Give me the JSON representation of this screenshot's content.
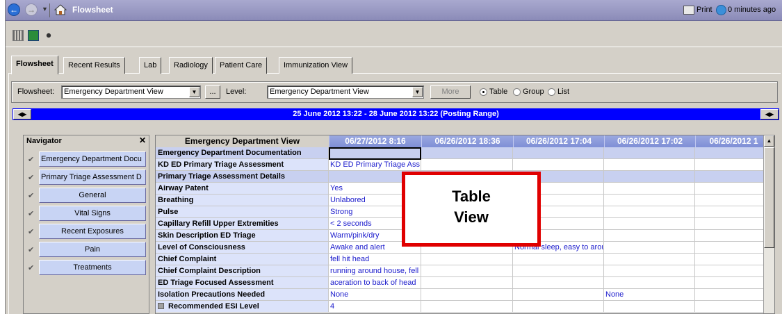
{
  "window": {
    "title": "Flowsheet",
    "print_label": "Print",
    "refresh_label": "0 minutes ago"
  },
  "tabs": [
    "Flowsheet",
    "Recent Results",
    "Lab",
    "Radiology",
    "Patient Care",
    "Immunization View"
  ],
  "filters": {
    "flowsheet_label": "Flowsheet:",
    "flowsheet_value": "Emergency Department View",
    "ellipsis": "...",
    "level_label": "Level:",
    "level_value": "Emergency Department View",
    "more_label": "More",
    "view_options": [
      "Table",
      "Group",
      "List"
    ],
    "selected_view": "Table"
  },
  "range": {
    "text": "25 June 2012 13:22 - 28 June 2012 13:22 (Posting Range)"
  },
  "navigator": {
    "title": "Navigator",
    "items": [
      "Emergency Department Docu",
      "Primary Triage Assessment D",
      "General",
      "Vital Signs",
      "Recent Exposures",
      "Pain",
      "Treatments"
    ]
  },
  "grid": {
    "first_header": "Emergency Department View",
    "columns": [
      "06/27/2012 8:16",
      "06/26/2012 18:36",
      "06/26/2012 17:04",
      "06/26/2012 17:02",
      "06/26/2012 1"
    ],
    "rows": [
      {
        "label": "Emergency Department Documentation",
        "section": true,
        "cells": [
          "",
          "",
          "",
          "",
          ""
        ]
      },
      {
        "label": "KD ED Primary Triage Assessment",
        "section": false,
        "cells": [
          "KD ED Primary Triage Ass",
          "",
          "",
          "",
          ""
        ]
      },
      {
        "label": "Primary Triage Assessment Details",
        "section": true,
        "cells": [
          "",
          "",
          "",
          "",
          ""
        ]
      },
      {
        "label": "Airway Patent",
        "section": false,
        "cells": [
          "Yes",
          "",
          "",
          "",
          ""
        ]
      },
      {
        "label": "Breathing",
        "section": false,
        "cells": [
          "Unlabored",
          "",
          "",
          "",
          ""
        ]
      },
      {
        "label": "Pulse",
        "section": false,
        "cells": [
          "Strong",
          "",
          "",
          "",
          ""
        ]
      },
      {
        "label": "Capillary Refill Upper Extremities",
        "section": false,
        "cells": [
          "< 2 seconds",
          "",
          "onds",
          "",
          ""
        ]
      },
      {
        "label": "Skin Description ED Triage",
        "section": false,
        "cells": [
          "Warm/pink/dry",
          "",
          "",
          "",
          ""
        ]
      },
      {
        "label": "Level of Consciousness",
        "section": false,
        "cells": [
          "Awake and alert",
          "",
          "Normal sleep, easy to arou",
          "",
          ""
        ]
      },
      {
        "label": "Chief Complaint",
        "section": false,
        "cells": [
          "fell hit head",
          "",
          "",
          "",
          ""
        ]
      },
      {
        "label": "Chief Complaint Description",
        "section": false,
        "cells": [
          "running around house, fell",
          "",
          "",
          "",
          ""
        ]
      },
      {
        "label": "ED Triage Focused Assessment",
        "section": false,
        "cells": [
          "aceration to back of head",
          "",
          "",
          "",
          ""
        ]
      },
      {
        "label": "Isolation Precautions Needed",
        "section": false,
        "cells": [
          "None",
          "",
          "",
          "None",
          ""
        ]
      },
      {
        "label": "Recommended ESI Level",
        "section": false,
        "cells": [
          "4",
          "",
          "",
          "",
          ""
        ]
      }
    ]
  },
  "annotation": {
    "line1": "Table",
    "line2": "View",
    "color": "#e00000"
  }
}
